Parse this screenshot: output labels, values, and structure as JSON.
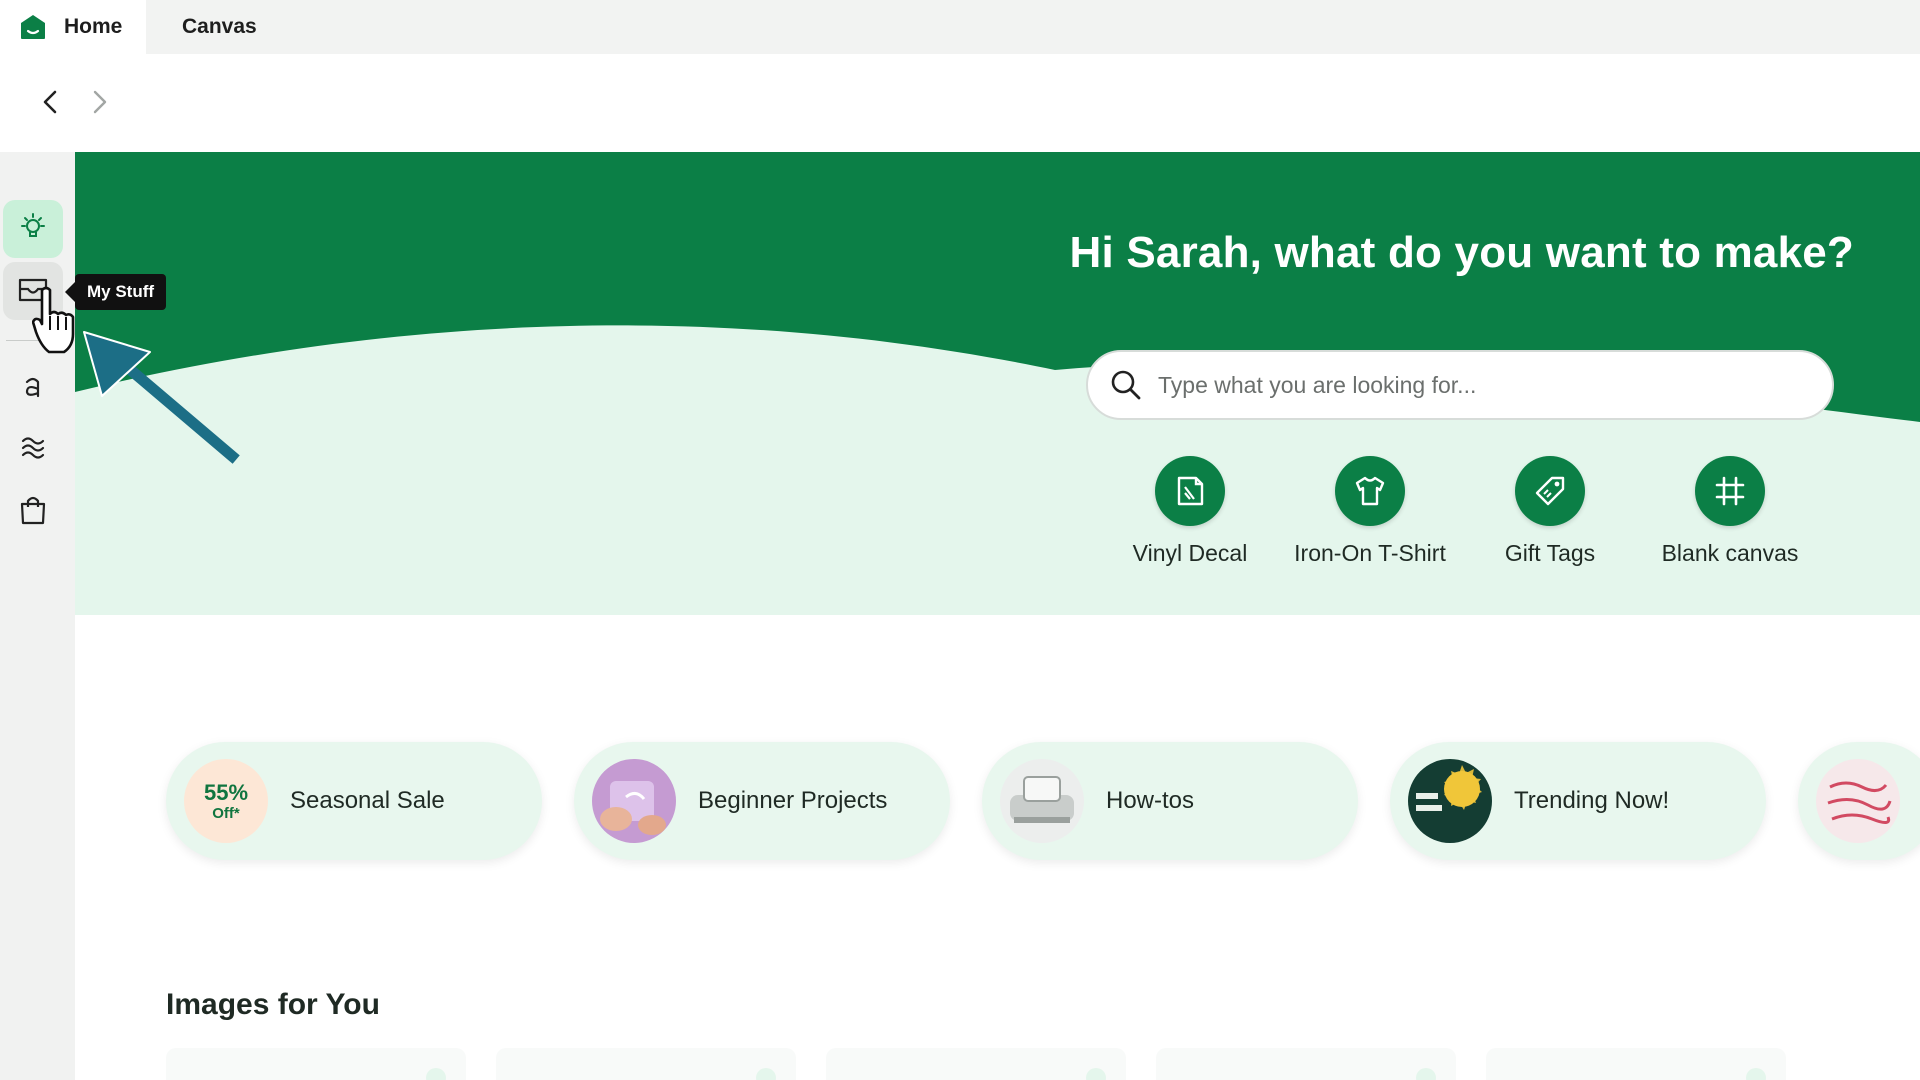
{
  "tabs": [
    {
      "label": "Home"
    },
    {
      "label": "Canvas"
    }
  ],
  "tooltip": {
    "text": "My Stuff"
  },
  "hero": {
    "title": "Hi Sarah, what do you want to make?",
    "search_placeholder": "Type what you are looking for..."
  },
  "quick_actions": [
    {
      "label": "Vinyl Decal",
      "icon": "vinyl-decal-icon"
    },
    {
      "label": "Iron-On T-Shirt",
      "icon": "tshirt-icon"
    },
    {
      "label": "Gift Tags",
      "icon": "tag-icon"
    },
    {
      "label": "Blank canvas",
      "icon": "blank-canvas-icon"
    }
  ],
  "categories": [
    {
      "label": "Seasonal Sale",
      "badge_big": "55%",
      "badge_small": "Off*"
    },
    {
      "label": "Beginner Projects"
    },
    {
      "label": "How-tos"
    },
    {
      "label": "Trending Now!"
    }
  ],
  "section": {
    "title": "Images for You"
  },
  "colors": {
    "brand_green": "#0b7f46",
    "hero_light": "#e4f6ec",
    "active_nav": "#c9f0d9",
    "annotation_arrow": "#1c6e86"
  }
}
